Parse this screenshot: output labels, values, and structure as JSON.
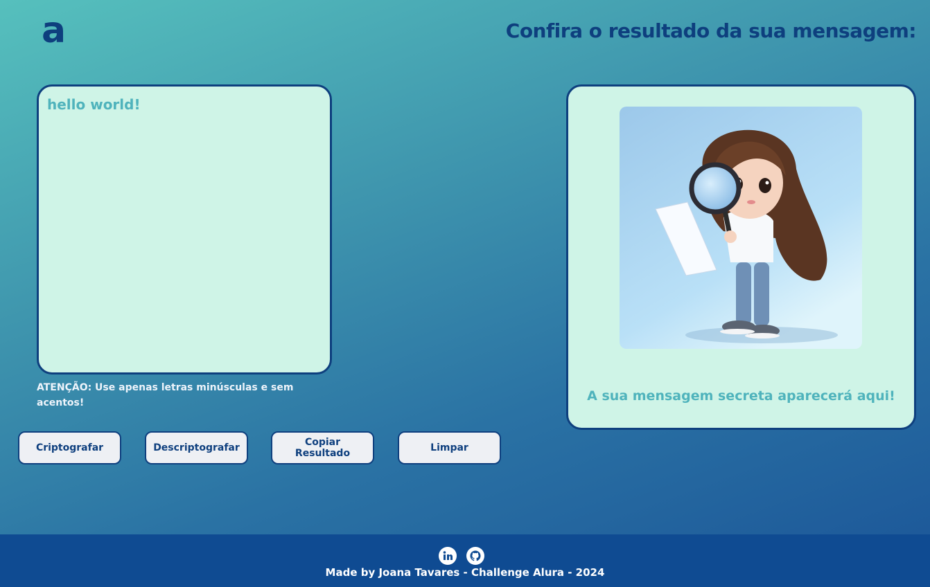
{
  "header": {
    "logo_text": "a",
    "result_title": "Confira o resultado da sua mensagem:"
  },
  "input": {
    "value": "hello world!"
  },
  "warning": {
    "text": "ATENÇÃO: Use apenas letras minúsculas e sem acentos!"
  },
  "buttons": {
    "encrypt": "Criptografar",
    "decrypt": "Descriptografar",
    "copy": "Copiar Resultado",
    "clear": "Limpar"
  },
  "result": {
    "message": "A sua mensagem secreta aparecerá aqui!",
    "illustration_icon": "girl-with-magnifying-glass"
  },
  "footer": {
    "credit": "Made by Joana Tavares - Challenge Alura - 2024",
    "icons": [
      "linkedin-icon",
      "github-icon"
    ]
  },
  "colors": {
    "brand": "#0e3f7e",
    "panel": "#cff4e7",
    "accent_text": "#4fb3bc",
    "footer": "#0f4b92"
  }
}
